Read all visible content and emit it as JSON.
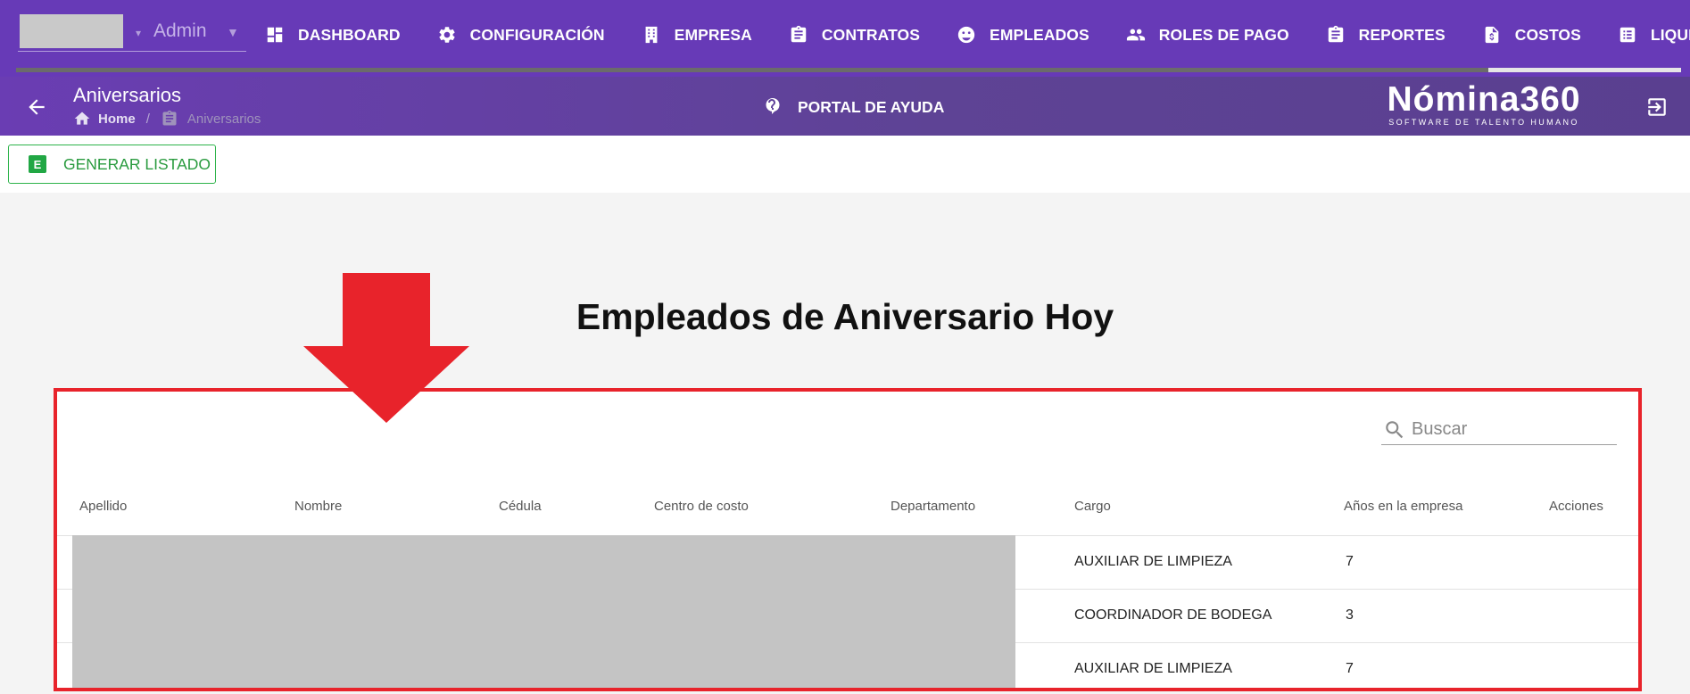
{
  "user": {
    "name": "Admin"
  },
  "nav": {
    "items": [
      {
        "label": "DASHBOARD",
        "icon": "dashboard-icon"
      },
      {
        "label": "CONFIGURACIÓN",
        "icon": "gear-icon"
      },
      {
        "label": "EMPRESA",
        "icon": "building-icon"
      },
      {
        "label": "CONTRATOS",
        "icon": "clipboard-icon"
      },
      {
        "label": "EMPLEADOS",
        "icon": "employees-icon"
      },
      {
        "label": "ROLES DE PAGO",
        "icon": "people-icon"
      },
      {
        "label": "REPORTES",
        "icon": "clipboard-icon"
      },
      {
        "label": "COSTOS",
        "icon": "invoice-icon"
      },
      {
        "label": "LIQUIDACIONE",
        "icon": "list-icon"
      }
    ]
  },
  "header": {
    "title": "Aniversarios",
    "breadcrumb": {
      "home": "Home",
      "current": "Aniversarios",
      "separator": "/"
    },
    "help": "PORTAL DE AYUDA",
    "logo": {
      "main": "Nómina360",
      "sub": "SOFTWARE DE TALENTO HUMANO"
    }
  },
  "toolbar": {
    "generate_label": "GENERAR LISTADO",
    "excel_letter": "E"
  },
  "main": {
    "title": "Empleados de Aniversario Hoy",
    "search_placeholder": "Buscar",
    "columns": [
      "Apellido",
      "Nombre",
      "Cédula",
      "Centro de costo",
      "Departamento",
      "Cargo",
      "Años en la empresa",
      "Acciones"
    ],
    "rows": [
      {
        "cargo": "AUXILIAR DE LIMPIEZA",
        "anios": "7"
      },
      {
        "cargo": "COORDINADOR DE BODEGA",
        "anios": "3"
      },
      {
        "cargo": "AUXILIAR DE LIMPIEZA",
        "anios": "7"
      }
    ]
  },
  "colors": {
    "nav_bg": "#673ab7",
    "highlight": "#e8232b",
    "excel_green": "#21a744"
  }
}
